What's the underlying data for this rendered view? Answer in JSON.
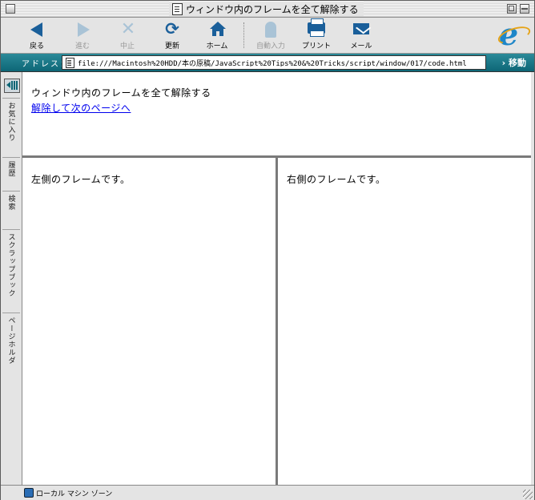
{
  "window": {
    "title": "ウィンドウ内のフレームを全て解除する"
  },
  "toolbar": {
    "back": "戻る",
    "forward": "進む",
    "stop": "中止",
    "refresh": "更新",
    "home": "ホーム",
    "autofill": "自動入力",
    "print": "プリント",
    "mail": "メール"
  },
  "address": {
    "label": "アドレス：",
    "url": "file:///Macintosh%20HDD/本の原稿/JavaScript%20Tips%20&%20Tricks/script/window/017/code.html",
    "go": "移動"
  },
  "sidebar": {
    "tabs": [
      "お気に入り",
      "履歴",
      "検索",
      "スクラップブック",
      "ページホルダ"
    ]
  },
  "frames": {
    "top": {
      "heading": "ウィンドウ内のフレームを全て解除する",
      "link": "解除して次のページへ"
    },
    "left": {
      "text": "左側のフレームです。"
    },
    "right": {
      "text": "右側のフレームです。"
    }
  },
  "status": {
    "zone": "ローカル マシン ゾーン"
  }
}
